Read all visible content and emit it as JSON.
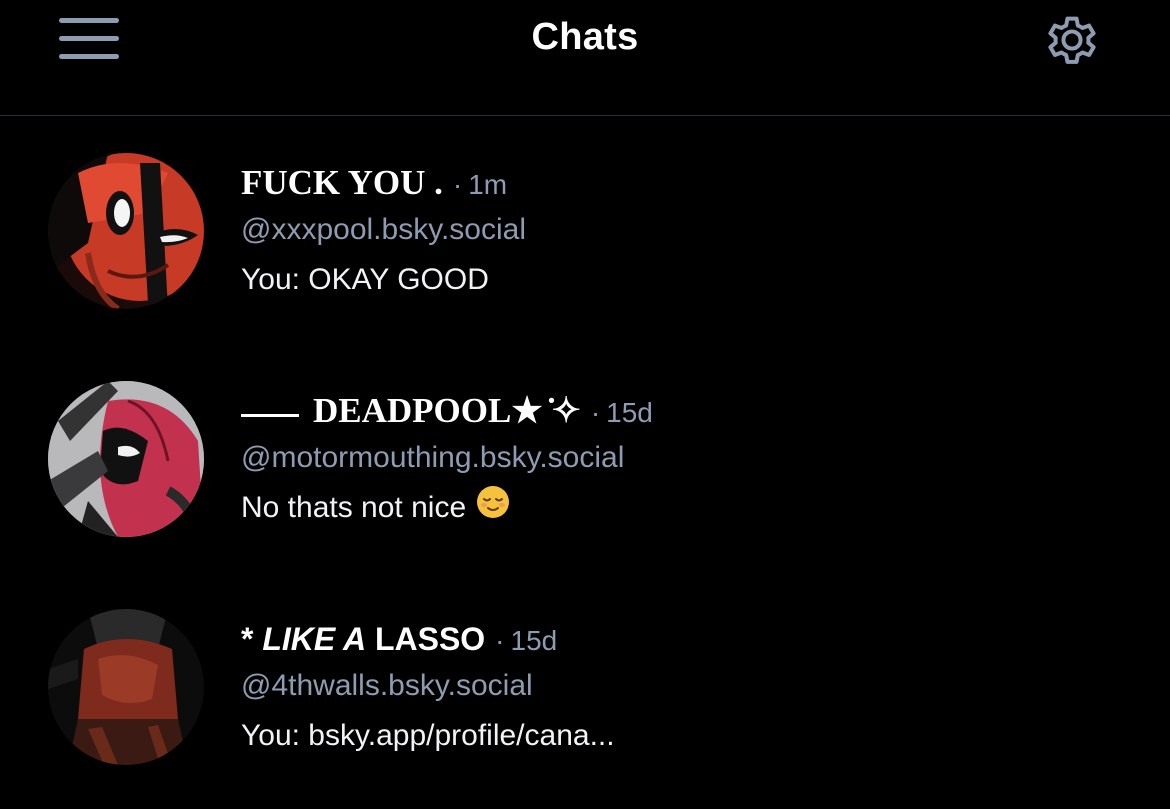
{
  "header": {
    "title": "Chats",
    "menu_icon": "hamburger-menu-icon",
    "settings_icon": "gear-icon"
  },
  "colors": {
    "background": "#000000",
    "text_primary": "#ffffff",
    "text_secondary": "#8e9cb2",
    "divider": "#2a2f38"
  },
  "separator": "·",
  "chats": [
    {
      "name": "FUCK YOU .",
      "time": "1m",
      "handle": "@xxxpool.bsky.social",
      "preview": "You: OKAY GOOD"
    },
    {
      "name_prefix": "——",
      "name": "DEADPOOL★ ̇✧",
      "time": "15d",
      "handle": "@motormouthing.bsky.social",
      "preview": "No thats not nice",
      "preview_emoji": "relieved-face-emoji"
    },
    {
      "name_part1": "* ",
      "name_part2": "LIKE A",
      "name_part3": " LASSO",
      "time": "15d",
      "handle": "@4thwalls.bsky.social",
      "preview": "You: bsky.app/profile/cana..."
    }
  ]
}
